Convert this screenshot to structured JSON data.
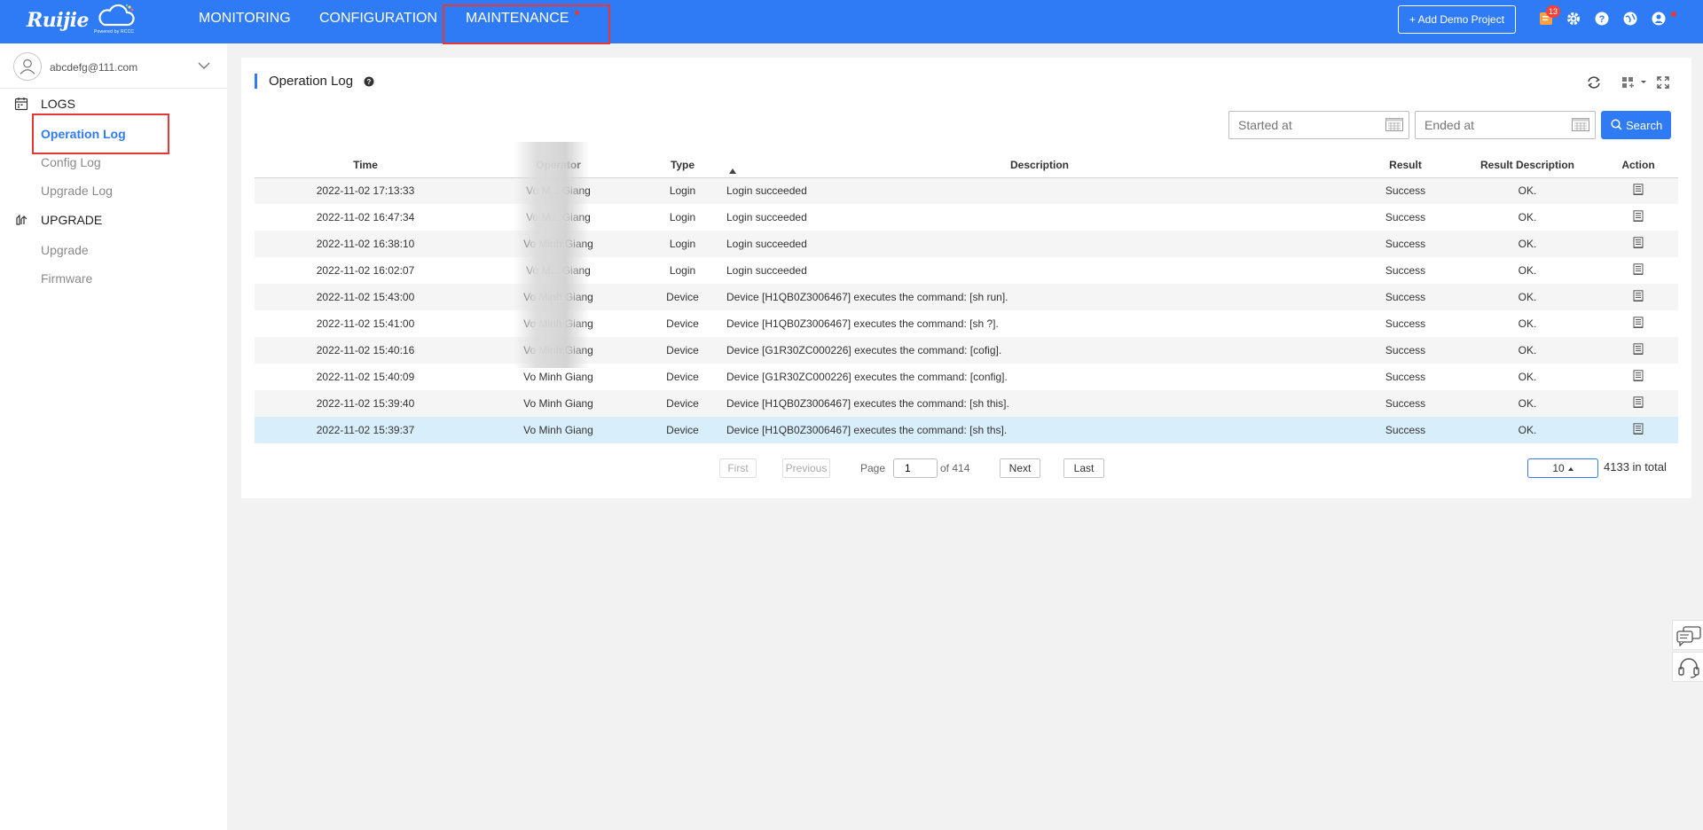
{
  "header": {
    "brand": "Ruijie",
    "powered_by": "Powered by RCCC",
    "nav": [
      "MONITORING",
      "CONFIGURATION",
      "MAINTENANCE"
    ],
    "demo_button": "+ Add Demo Project",
    "notification_count": "13",
    "accent_color": "#2f7bf5"
  },
  "sidebar": {
    "account": "abcdefg@111.com",
    "sections": [
      {
        "title": "LOGS",
        "items": [
          "Operation Log",
          "Config Log",
          "Upgrade Log"
        ]
      },
      {
        "title": "UPGRADE",
        "items": [
          "Upgrade",
          "Firmware"
        ]
      }
    ],
    "active_item": "Operation Log"
  },
  "main": {
    "title": "Operation Log",
    "started_placeholder": "Started at",
    "ended_placeholder": "Ended at",
    "search_label": "Search",
    "columns": [
      "Time",
      "Operator",
      "Type",
      "Description",
      "Result",
      "Result Description",
      "Action"
    ],
    "rows": [
      {
        "time": "2022-11-02 17:13:33",
        "operator": "Vo M... Giang",
        "type": "Login",
        "description": "Login succeeded",
        "result": "Success",
        "result_description": "OK."
      },
      {
        "time": "2022-11-02 16:47:34",
        "operator": "Vo M... Giang",
        "type": "Login",
        "description": "Login succeeded",
        "result": "Success",
        "result_description": "OK."
      },
      {
        "time": "2022-11-02 16:38:10",
        "operator": "Vo Minh Giang",
        "type": "Login",
        "description": "Login succeeded",
        "result": "Success",
        "result_description": "OK."
      },
      {
        "time": "2022-11-02 16:02:07",
        "operator": "Vo M... Giang",
        "type": "Login",
        "description": "Login succeeded",
        "result": "Success",
        "result_description": "OK."
      },
      {
        "time": "2022-11-02 15:43:00",
        "operator": "Vo Minh Giang",
        "type": "Device",
        "description": "Device [H1QB0Z3006467] executes the command: [sh run].",
        "result": "Success",
        "result_description": "OK."
      },
      {
        "time": "2022-11-02 15:41:00",
        "operator": "Vo Minh Giang",
        "type": "Device",
        "description": "Device [H1QB0Z3006467] executes the command: [sh ?].",
        "result": "Success",
        "result_description": "OK."
      },
      {
        "time": "2022-11-02 15:40:16",
        "operator": "Vo Minh Giang",
        "type": "Device",
        "description": "Device [G1R30ZC000226] executes the command: [cofig].",
        "result": "Success",
        "result_description": "OK."
      },
      {
        "time": "2022-11-02 15:40:09",
        "operator": "Vo Minh Giang",
        "type": "Device",
        "description": "Device [G1R30ZC000226] executes the command: [config].",
        "result": "Success",
        "result_description": "OK."
      },
      {
        "time": "2022-11-02 15:39:40",
        "operator": "Vo Minh Giang",
        "type": "Device",
        "description": "Device [H1QB0Z3006467] executes the command: [sh this].",
        "result": "Success",
        "result_description": "OK."
      },
      {
        "time": "2022-11-02 15:39:37",
        "operator": "Vo Minh Giang",
        "type": "Device",
        "description": "Device [H1QB0Z3006467] executes the command: [sh ths].",
        "result": "Success",
        "result_description": "OK."
      }
    ],
    "selected_row": 9,
    "pagination": {
      "first": "First",
      "previous": "Previous",
      "page_label": "Page",
      "page": "1",
      "of_label": "of 414",
      "next": "Next",
      "last": "Last",
      "page_size": "10",
      "total": "4133 in total"
    }
  }
}
